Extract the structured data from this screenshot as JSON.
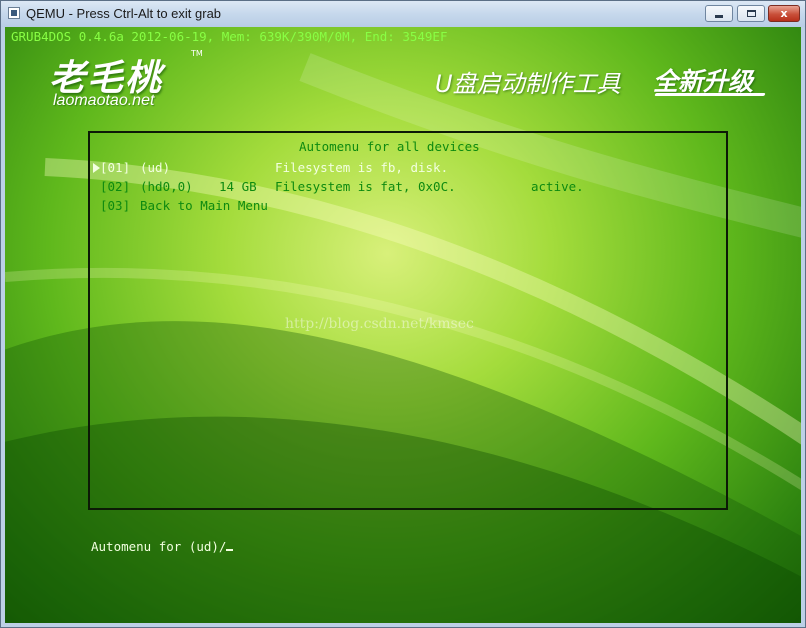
{
  "window": {
    "title": "QEMU - Press Ctrl-Alt to exit grab",
    "close_glyph": "x"
  },
  "grub": {
    "header": "GRUB4DOS 0.4.6a 2012-06-19, Mem: 639K/390M/0M, End: 3549EF"
  },
  "branding": {
    "logo_cn": "老毛桃",
    "trademark": "TM",
    "logo_url": "laomaotao.net",
    "slogan_left": "U盘启动制作工具",
    "slogan_right": "全新升级"
  },
  "menu": {
    "title": "Automenu for all devices",
    "items": [
      {
        "id": "[01]",
        "device": "(ud)",
        "size": "",
        "filesystem": "Filesystem is fb, disk.",
        "status": "",
        "selected": true
      },
      {
        "id": "[02]",
        "device": "(hd0,0)",
        "size": "14 GB",
        "filesystem": "Filesystem is fat, 0x0C.",
        "status": "active.",
        "selected": false
      },
      {
        "id": "[03]",
        "device": "Back to Main Menu",
        "size": "",
        "filesystem": "",
        "status": "",
        "selected": false
      }
    ]
  },
  "watermark": "http://blog.csdn.net/kmsec",
  "command_line": "Automenu for (ud)/",
  "colors": {
    "menu_text": "#0d8a10",
    "selected_text": "#f2ffe0",
    "header_text": "#88ff44"
  }
}
